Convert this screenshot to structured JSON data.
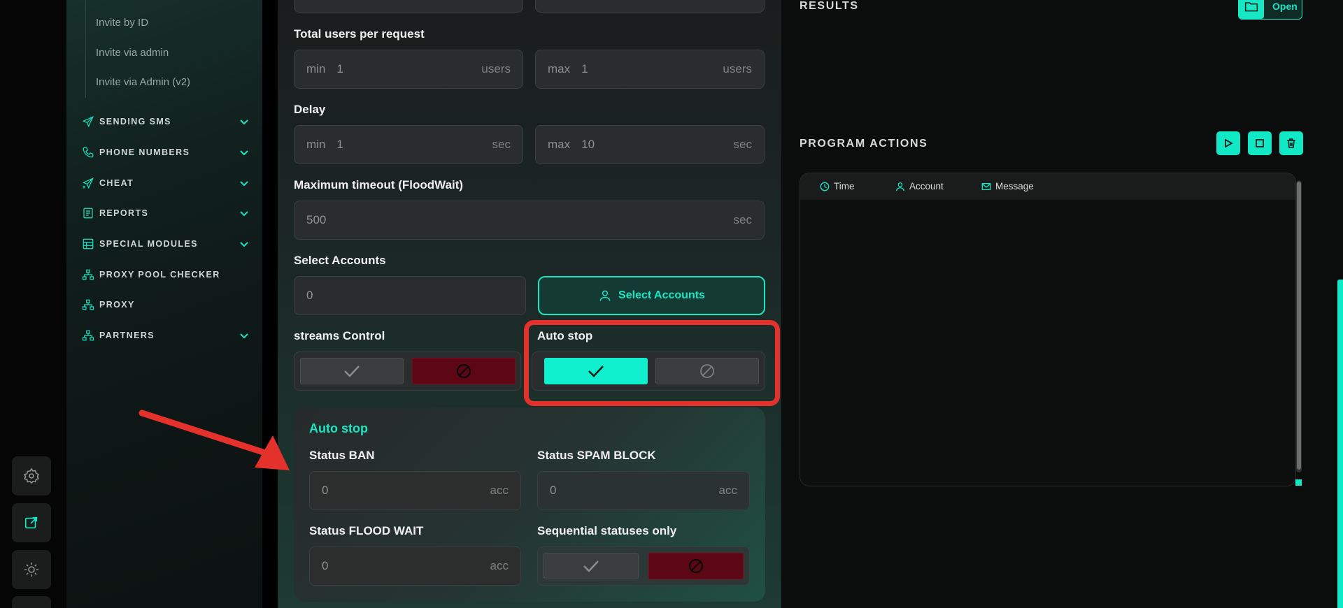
{
  "sidebar": {
    "sub_items": [
      "Invite by ID",
      "Invite via admin",
      "Invite via Admin (v2)"
    ],
    "nav": [
      {
        "label": "SENDING SMS",
        "icon": "paper-plane-icon",
        "expandable": true
      },
      {
        "label": "PHONE NUMBERS",
        "icon": "phone-icon",
        "expandable": true
      },
      {
        "label": "CHEAT",
        "icon": "paper-plane-plus-icon",
        "expandable": true
      },
      {
        "label": "REPORTS",
        "icon": "report-icon",
        "expandable": true
      },
      {
        "label": "SPECIAL MODULES",
        "icon": "table-icon",
        "expandable": true
      },
      {
        "label": "PROXY POOL CHECKER",
        "icon": "network-icon",
        "expandable": false
      },
      {
        "label": "PROXY",
        "icon": "network-icon",
        "expandable": false
      },
      {
        "label": "PARTNERS",
        "icon": "network-icon",
        "expandable": true
      }
    ]
  },
  "rail": {
    "icons": [
      "gear-icon",
      "external-link-icon",
      "sun-icon"
    ]
  },
  "form": {
    "total_users": {
      "label": "Total users per request",
      "min": {
        "prefix": "min",
        "value": "1",
        "unit": "users"
      },
      "max": {
        "prefix": "max",
        "value": "1",
        "unit": "users"
      }
    },
    "delay": {
      "label": "Delay",
      "min": {
        "prefix": "min",
        "value": "1",
        "unit": "sec"
      },
      "max": {
        "prefix": "max",
        "value": "10",
        "unit": "sec"
      }
    },
    "timeout": {
      "label": "Maximum timeout (FloodWait)",
      "value": "500",
      "unit": "sec"
    },
    "accounts": {
      "label": "Select Accounts",
      "value": "0",
      "button": "Select Accounts"
    },
    "streams": {
      "label": "streams Control",
      "enabled": false
    },
    "auto_stop": {
      "label": "Auto stop",
      "enabled": true
    },
    "auto_stop_panel": {
      "title": "Auto stop",
      "ban": {
        "label": "Status BAN",
        "value": "0",
        "unit": "acc"
      },
      "spam": {
        "label": "Status SPAM BLOCK",
        "value": "0",
        "unit": "acc"
      },
      "flood": {
        "label": "Status FLOOD WAIT",
        "value": "0",
        "unit": "acc"
      },
      "sequential": {
        "label": "Sequential statuses only",
        "enabled": false
      }
    }
  },
  "results": {
    "title": "RESULTS",
    "open_label": "Open"
  },
  "actions": {
    "title": "PROGRAM ACTIONS",
    "columns": [
      "Time",
      "Account",
      "Message"
    ]
  },
  "colors": {
    "accent": "#18e7c4",
    "danger": "#5d0614",
    "highlight": "#e5312c"
  }
}
